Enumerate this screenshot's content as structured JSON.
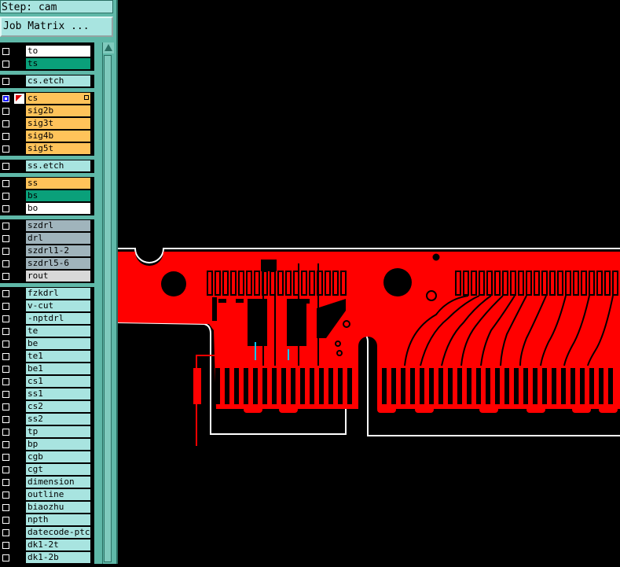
{
  "step": {
    "label": "Step: cam"
  },
  "job_matrix_button": "Job Matrix ...",
  "colors": {
    "white": "#ffffff",
    "green": "#0aa07a",
    "cyan": "#a8e4e0",
    "orange": "#ffc35a",
    "grey": "#a0b4bc",
    "lightgrey": "#d8d8d8"
  },
  "layers": [
    {
      "name": "to",
      "color": "#ffffff",
      "text_color": "#000"
    },
    {
      "name": "ts",
      "color": "#0aa07a",
      "text_color": "#000"
    },
    {
      "sep": true
    },
    {
      "name": "cs.etch",
      "color": "#a8e4e0",
      "text_color": "#000"
    },
    {
      "sep": true
    },
    {
      "name": "cs",
      "color": "#ffc35a",
      "text_color": "#000",
      "active": true
    },
    {
      "name": "sig2b",
      "color": "#ffc35a",
      "text_color": "#000"
    },
    {
      "name": "sig3t",
      "color": "#ffc35a",
      "text_color": "#000"
    },
    {
      "name": "sig4b",
      "color": "#ffc35a",
      "text_color": "#000"
    },
    {
      "name": "sig5t",
      "color": "#ffc35a",
      "text_color": "#000"
    },
    {
      "sep": true
    },
    {
      "name": "ss.etch",
      "color": "#a8e4e0",
      "text_color": "#000"
    },
    {
      "sep": true
    },
    {
      "name": "ss",
      "color": "#ffc35a",
      "text_color": "#000"
    },
    {
      "name": "bs",
      "color": "#0aa07a",
      "text_color": "#000"
    },
    {
      "name": "bo",
      "color": "#ffffff",
      "text_color": "#000"
    },
    {
      "sep": true
    },
    {
      "name": "szdrl",
      "color": "#a0b4bc",
      "text_color": "#000"
    },
    {
      "name": "drl",
      "color": "#a0b4bc",
      "text_color": "#000"
    },
    {
      "name": "szdrl1-2",
      "color": "#a0b4bc",
      "text_color": "#000"
    },
    {
      "name": "szdrl5-6",
      "color": "#a0b4bc",
      "text_color": "#000"
    },
    {
      "name": "rout",
      "color": "#d8d8d8",
      "text_color": "#000"
    },
    {
      "sep": true
    },
    {
      "name": "fzkdrl",
      "color": "#a8e4e0",
      "text_color": "#000"
    },
    {
      "name": "v-cut",
      "color": "#a8e4e0",
      "text_color": "#000"
    },
    {
      "name": "-nptdrl",
      "color": "#a8e4e0",
      "text_color": "#000"
    },
    {
      "name": "te",
      "color": "#a8e4e0",
      "text_color": "#000"
    },
    {
      "name": "be",
      "color": "#a8e4e0",
      "text_color": "#000"
    },
    {
      "name": "te1",
      "color": "#a8e4e0",
      "text_color": "#000"
    },
    {
      "name": "be1",
      "color": "#a8e4e0",
      "text_color": "#000"
    },
    {
      "name": "cs1",
      "color": "#a8e4e0",
      "text_color": "#000"
    },
    {
      "name": "ss1",
      "color": "#a8e4e0",
      "text_color": "#000"
    },
    {
      "name": "cs2",
      "color": "#a8e4e0",
      "text_color": "#000"
    },
    {
      "name": "ss2",
      "color": "#a8e4e0",
      "text_color": "#000"
    },
    {
      "name": "tp",
      "color": "#a8e4e0",
      "text_color": "#000"
    },
    {
      "name": "bp",
      "color": "#a8e4e0",
      "text_color": "#000"
    },
    {
      "name": "cgb",
      "color": "#a8e4e0",
      "text_color": "#000"
    },
    {
      "name": "cgt",
      "color": "#a8e4e0",
      "text_color": "#000"
    },
    {
      "name": "dimension",
      "color": "#a8e4e0",
      "text_color": "#000"
    },
    {
      "name": "outline",
      "color": "#a8e4e0",
      "text_color": "#000"
    },
    {
      "name": "biaozhu",
      "color": "#a8e4e0",
      "text_color": "#000"
    },
    {
      "name": "npth",
      "color": "#a8e4e0",
      "text_color": "#000"
    },
    {
      "name": "datecode-ptc",
      "color": "#a8e4e0",
      "text_color": "#000"
    },
    {
      "name": "dk1-2t",
      "color": "#a8e4e0",
      "text_color": "#000"
    },
    {
      "name": "dk1-2b",
      "color": "#a8e4e0",
      "text_color": "#000"
    }
  ]
}
